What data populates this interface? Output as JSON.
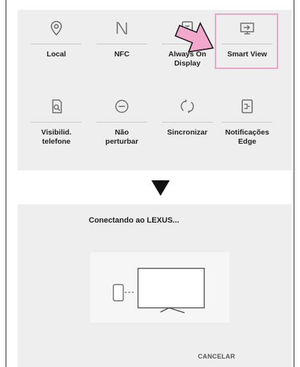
{
  "quick_settings": {
    "tiles": [
      {
        "label": "Local",
        "icon": "location-icon"
      },
      {
        "label": "NFC",
        "icon": "nfc-icon"
      },
      {
        "label": "Always On\nDisplay",
        "icon": "always-on-display-icon"
      },
      {
        "label": "Smart View",
        "icon": "smart-view-icon"
      },
      {
        "label": "Visibilid.\ntelefone",
        "icon": "phone-visibility-icon"
      },
      {
        "label": "Não\nperturbar",
        "icon": "do-not-disturb-icon"
      },
      {
        "label": "Sincronizar",
        "icon": "sync-icon"
      },
      {
        "label": "Notificações\nEdge",
        "icon": "edge-notifications-icon"
      }
    ]
  },
  "annotations": {
    "pointer_color": "#f2a8cc",
    "highlight_color": "#e8a6c4"
  },
  "dialog": {
    "title": "Conectando ao LEXUS...",
    "cancel_label": "CANCELAR"
  }
}
